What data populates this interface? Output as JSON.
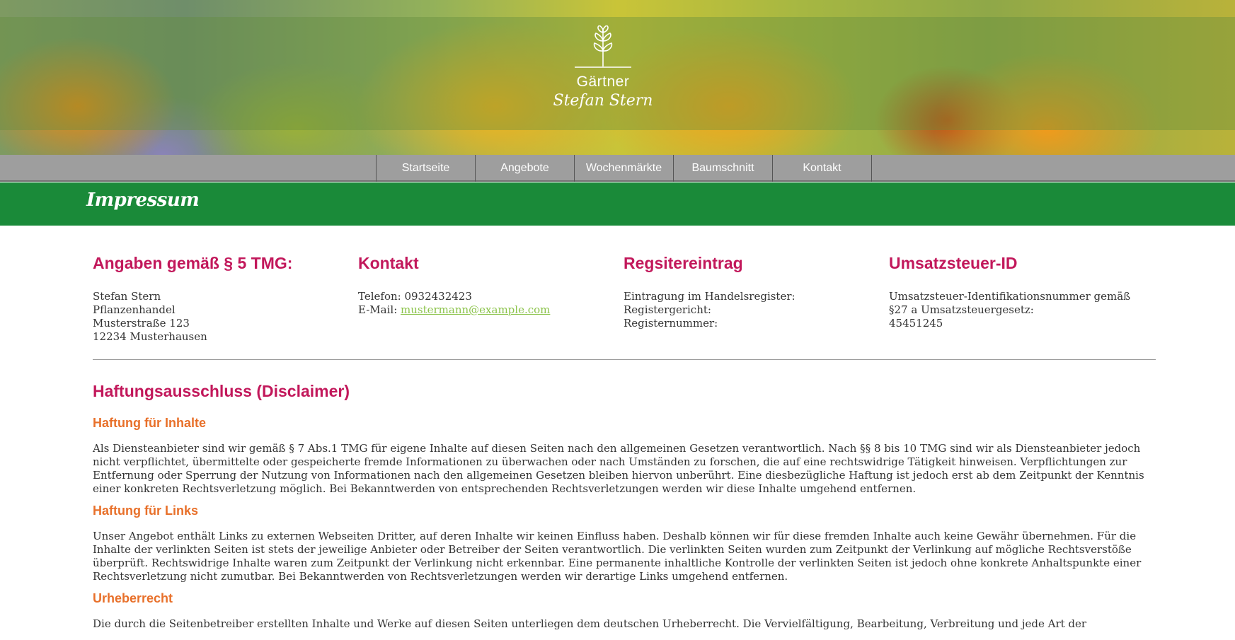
{
  "header": {
    "logo_line1": "Gärtner",
    "logo_line2": "Stefan Stern"
  },
  "nav": {
    "items": [
      {
        "label": "Startseite"
      },
      {
        "label": "Angebote"
      },
      {
        "label": "Wochenmärkte"
      },
      {
        "label": "Baumschnitt"
      },
      {
        "label": "Kontakt"
      }
    ]
  },
  "page": {
    "title": "Impressum"
  },
  "columns": {
    "angaben": {
      "heading": "Angaben gemäß § 5 TMG:",
      "lines": [
        "Stefan Stern",
        "Pflanzenhandel",
        "Musterstraße 123",
        "12234 Musterhausen"
      ]
    },
    "kontakt": {
      "heading": "Kontakt",
      "phone": "Telefon: 0932432423",
      "email_label": "E-Mail: ",
      "email": "mustermann@example.com"
    },
    "register": {
      "heading": "Regsitereintrag",
      "lines": [
        "Eintragung im Handelsregister:",
        "Registergericht:",
        "Registernummer:"
      ]
    },
    "ust": {
      "heading": "Umsatzsteuer-ID",
      "lines": [
        "Umsatzsteuer-Identifikationsnummer gemäß",
        "§27 a Umsatzsteuergesetz:",
        "45451245"
      ]
    }
  },
  "disclaimer": {
    "heading": "Haftungsausschluss (Disclaimer)",
    "sections": [
      {
        "title": "Haftung für Inhalte",
        "text": "Als Diensteanbieter sind wir gemäß § 7 Abs.1 TMG für eigene Inhalte auf diesen Seiten nach den allgemeinen Gesetzen verantwortlich. Nach §§ 8 bis 10 TMG sind wir als Diensteanbieter jedoch nicht verpflichtet, übermittelte oder gespeicherte fremde Informationen zu überwachen oder nach Umständen zu forschen, die auf eine rechtswidrige Tätigkeit hinweisen. Verpflichtungen zur Entfernung oder Sperrung der Nutzung von Informationen nach den allgemeinen Gesetzen bleiben hiervon unberührt. Eine diesbezügliche Haftung ist jedoch erst ab dem Zeitpunkt der Kenntnis einer konkreten Rechtsverletzung möglich. Bei Bekanntwerden von entsprechenden Rechtsverletzungen werden wir diese Inhalte umgehend entfernen."
      },
      {
        "title": "Haftung für Links",
        "text": "Unser Angebot enthält Links zu externen Webseiten Dritter, auf deren Inhalte wir keinen Einfluss haben. Deshalb können wir für diese fremden Inhalte auch keine Gewähr übernehmen. Für die Inhalte der verlinkten Seiten ist stets der jeweilige Anbieter oder Betreiber der Seiten verantwortlich. Die verlinkten Seiten wurden zum Zeitpunkt der Verlinkung auf mögliche Rechtsverstöße überprüft. Rechtswidrige Inhalte waren zum Zeitpunkt der Verlinkung nicht erkennbar. Eine permanente inhaltliche Kontrolle der verlinkten Seiten ist jedoch ohne konkrete Anhaltspunkte einer Rechtsverletzung nicht zumutbar. Bei Bekanntwerden von Rechtsverletzungen werden wir derartige Links umgehend entfernen."
      },
      {
        "title": "Urheberrecht",
        "text": "Die durch die Seitenbetreiber erstellten Inhalte und Werke auf diesen Seiten unterliegen dem deutschen Urheberrecht. Die Vervielfältigung, Bearbeitung, Verbreitung und jede Art der"
      }
    ]
  },
  "colors": {
    "nav_bg": "#9e9e9e",
    "title_bar": "#1a8a39",
    "heading_pink": "#c2185b",
    "subheading_orange": "#e8702a",
    "link_green": "#8bc34a"
  }
}
